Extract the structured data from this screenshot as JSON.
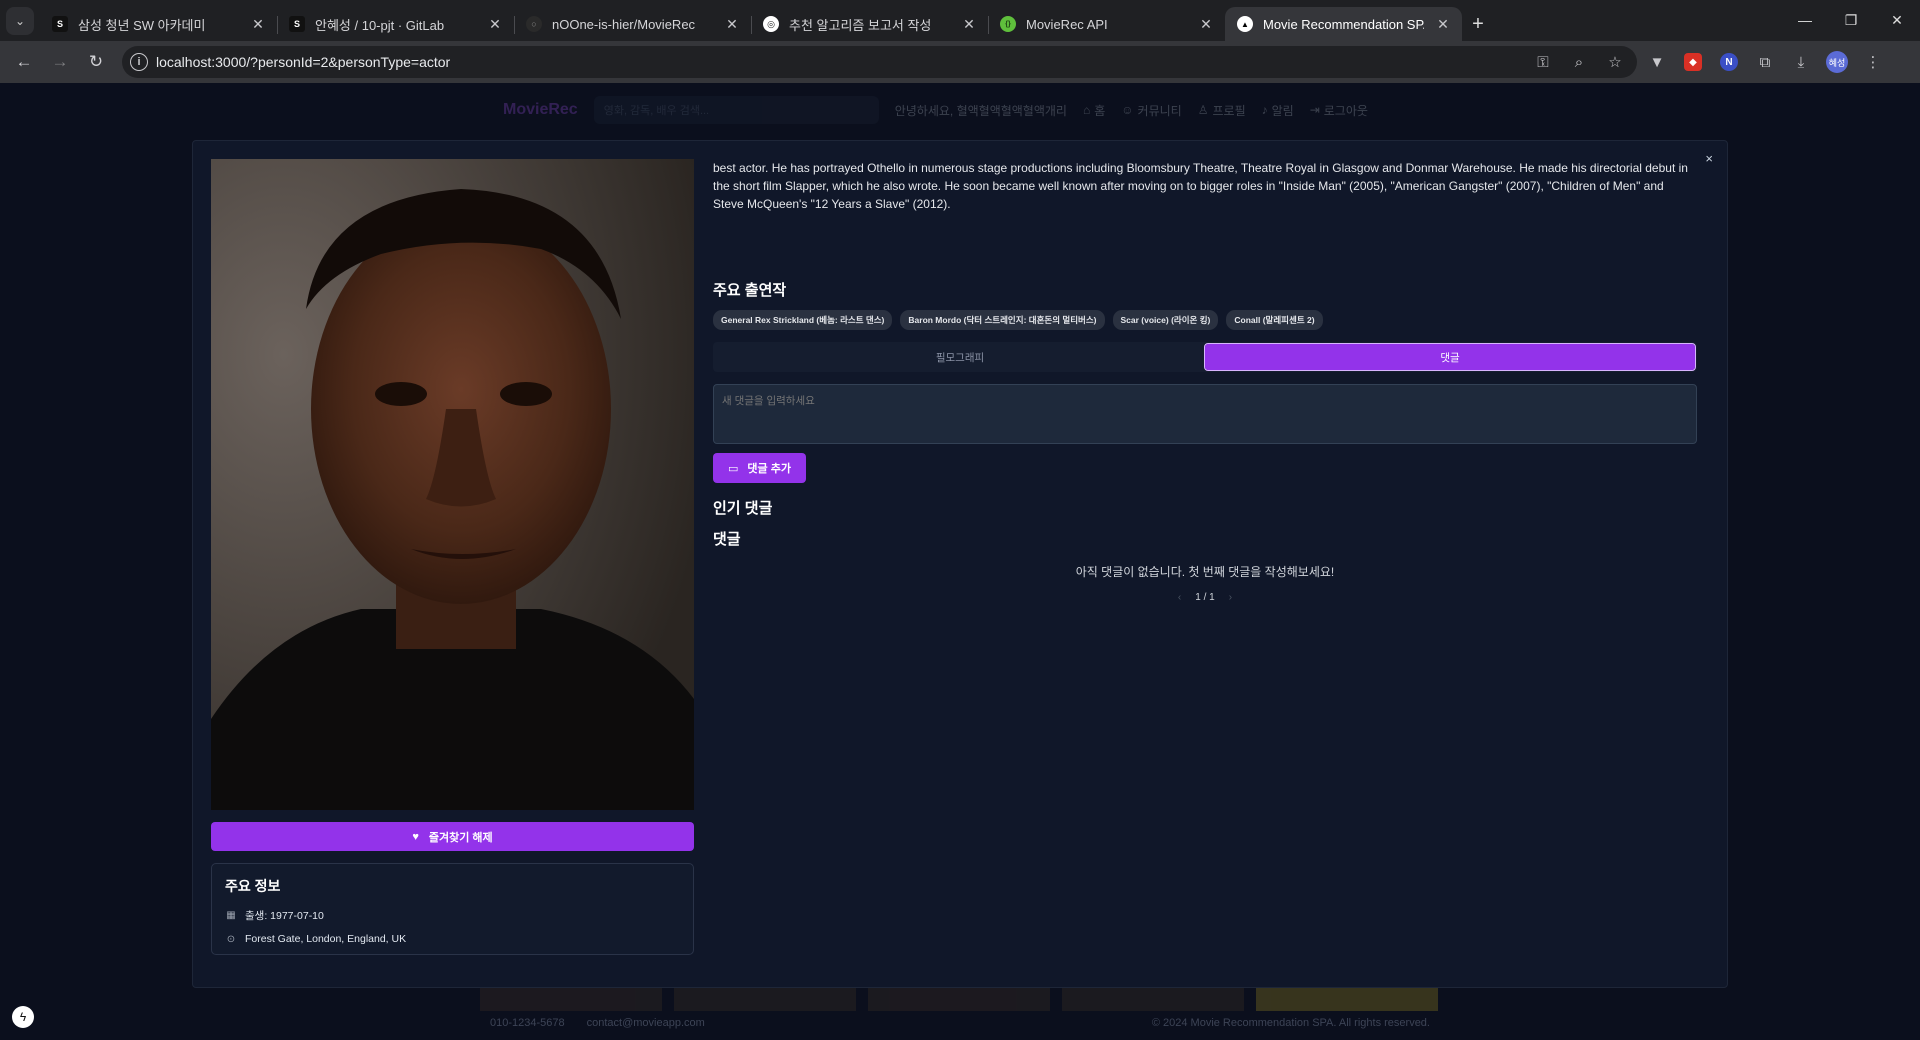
{
  "browser": {
    "tabs": [
      {
        "title": "삼성 청년 SW 아카데미",
        "fav_color": "#111111",
        "fav_glyph": "S"
      },
      {
        "title": "안혜성 / 10-pjt · GitLab",
        "fav_color": "#111111",
        "fav_glyph": "S"
      },
      {
        "title": "nOOne-is-hier/MovieRec",
        "fav_color": "#2a2a2a",
        "fav_glyph": "○"
      },
      {
        "title": "추천 알고리즘 보고서 작성",
        "fav_color": "#ffffff",
        "fav_glyph": "◎"
      },
      {
        "title": "MovieRec API",
        "fav_color": "#5fbf3c",
        "fav_glyph": "{}"
      },
      {
        "title": "Movie Recommendation SPA",
        "fav_color": "#ffffff",
        "fav_glyph": "▲"
      }
    ],
    "url": "localhost:3000/?personId=2&personType=actor",
    "profile_label": "혜성"
  },
  "site": {
    "logo": "MovieRec",
    "search_placeholder": "영화, 감독, 배우 검색...",
    "greeting": "안녕하세요, 혈액혈액혈액혈액개리",
    "nav": [
      "홈",
      "커뮤니티",
      "프로필",
      "알림",
      "로그아웃"
    ],
    "footer_phone": "010-1234-5678",
    "footer_email": "contact@movieapp.com",
    "footer_copy": "© 2024 Movie Recommendation SPA. All rights reserved."
  },
  "modal": {
    "close": "×",
    "favorite_label": "즐겨찾기 해제",
    "info_title": "주요 정보",
    "birth": "출생: 1977-07-10",
    "birthplace": "Forest Gate, London, England, UK",
    "bio": "best actor. He has portrayed Othello in numerous stage productions including Bloomsbury Theatre, Theatre Royal in Glasgow and Donmar Warehouse. He made his directorial debut in the short film Slapper, which he also wrote. He soon became well known after moving on to bigger roles in \"Inside Man\" (2005), \"American Gangster\" (2007), \"Children of Men\" and Steve McQueen's \"12 Years a Slave\" (2012).",
    "works_title": "주요 출연작",
    "works": [
      "General Rex Strickland (베놈: 라스트 댄스)",
      "Baron Mordo (닥터 스트레인지: 대혼돈의 멀티버스)",
      "Scar (voice) (라이온 킹)",
      "Conall (말레피센트 2)"
    ],
    "tabs": [
      "필모그래피",
      "댓글"
    ],
    "active_tab": 1,
    "comment_placeholder": "새 댓글을 입력하세요",
    "add_comment": "댓글 추가",
    "popular_title": "인기 댓글",
    "comments_title": "댓글",
    "empty_text": "아직 댓글이 없습니다. 첫 번째 댓글을 작성해보세요!",
    "pager": "1 / 1"
  }
}
